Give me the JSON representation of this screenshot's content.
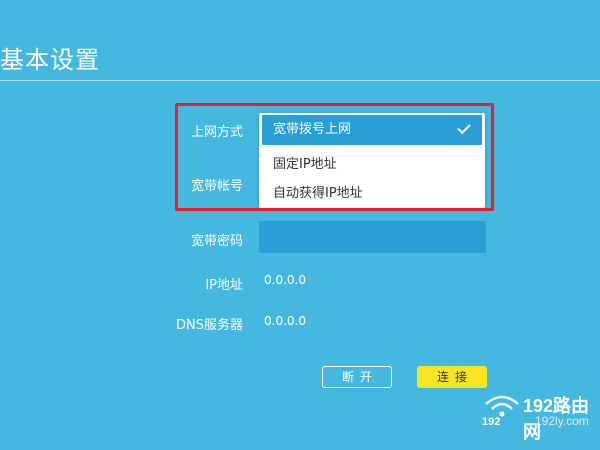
{
  "page": {
    "title": "基本设置"
  },
  "form": {
    "connection_type": {
      "label": "上网方式",
      "selected": "宽带拨号上网",
      "options": [
        "固定IP地址",
        "自动获得IP地址"
      ]
    },
    "account": {
      "label": "宽带帐号"
    },
    "password": {
      "label": "宽带密码",
      "value": ""
    },
    "ip": {
      "label": "IP地址",
      "value": "0.0.0.0"
    },
    "dns": {
      "label": "DNS服务器",
      "value": "0.0.0.0"
    }
  },
  "buttons": {
    "disconnect": "断开",
    "connect": "连接"
  },
  "watermark": {
    "brand": "192路由网",
    "url": "192ly.com",
    "number": "192"
  },
  "colors": {
    "background": "#45b8e0",
    "field": "#2a9fd6",
    "highlight": "#e8202a",
    "connect_button": "#f7e620"
  }
}
